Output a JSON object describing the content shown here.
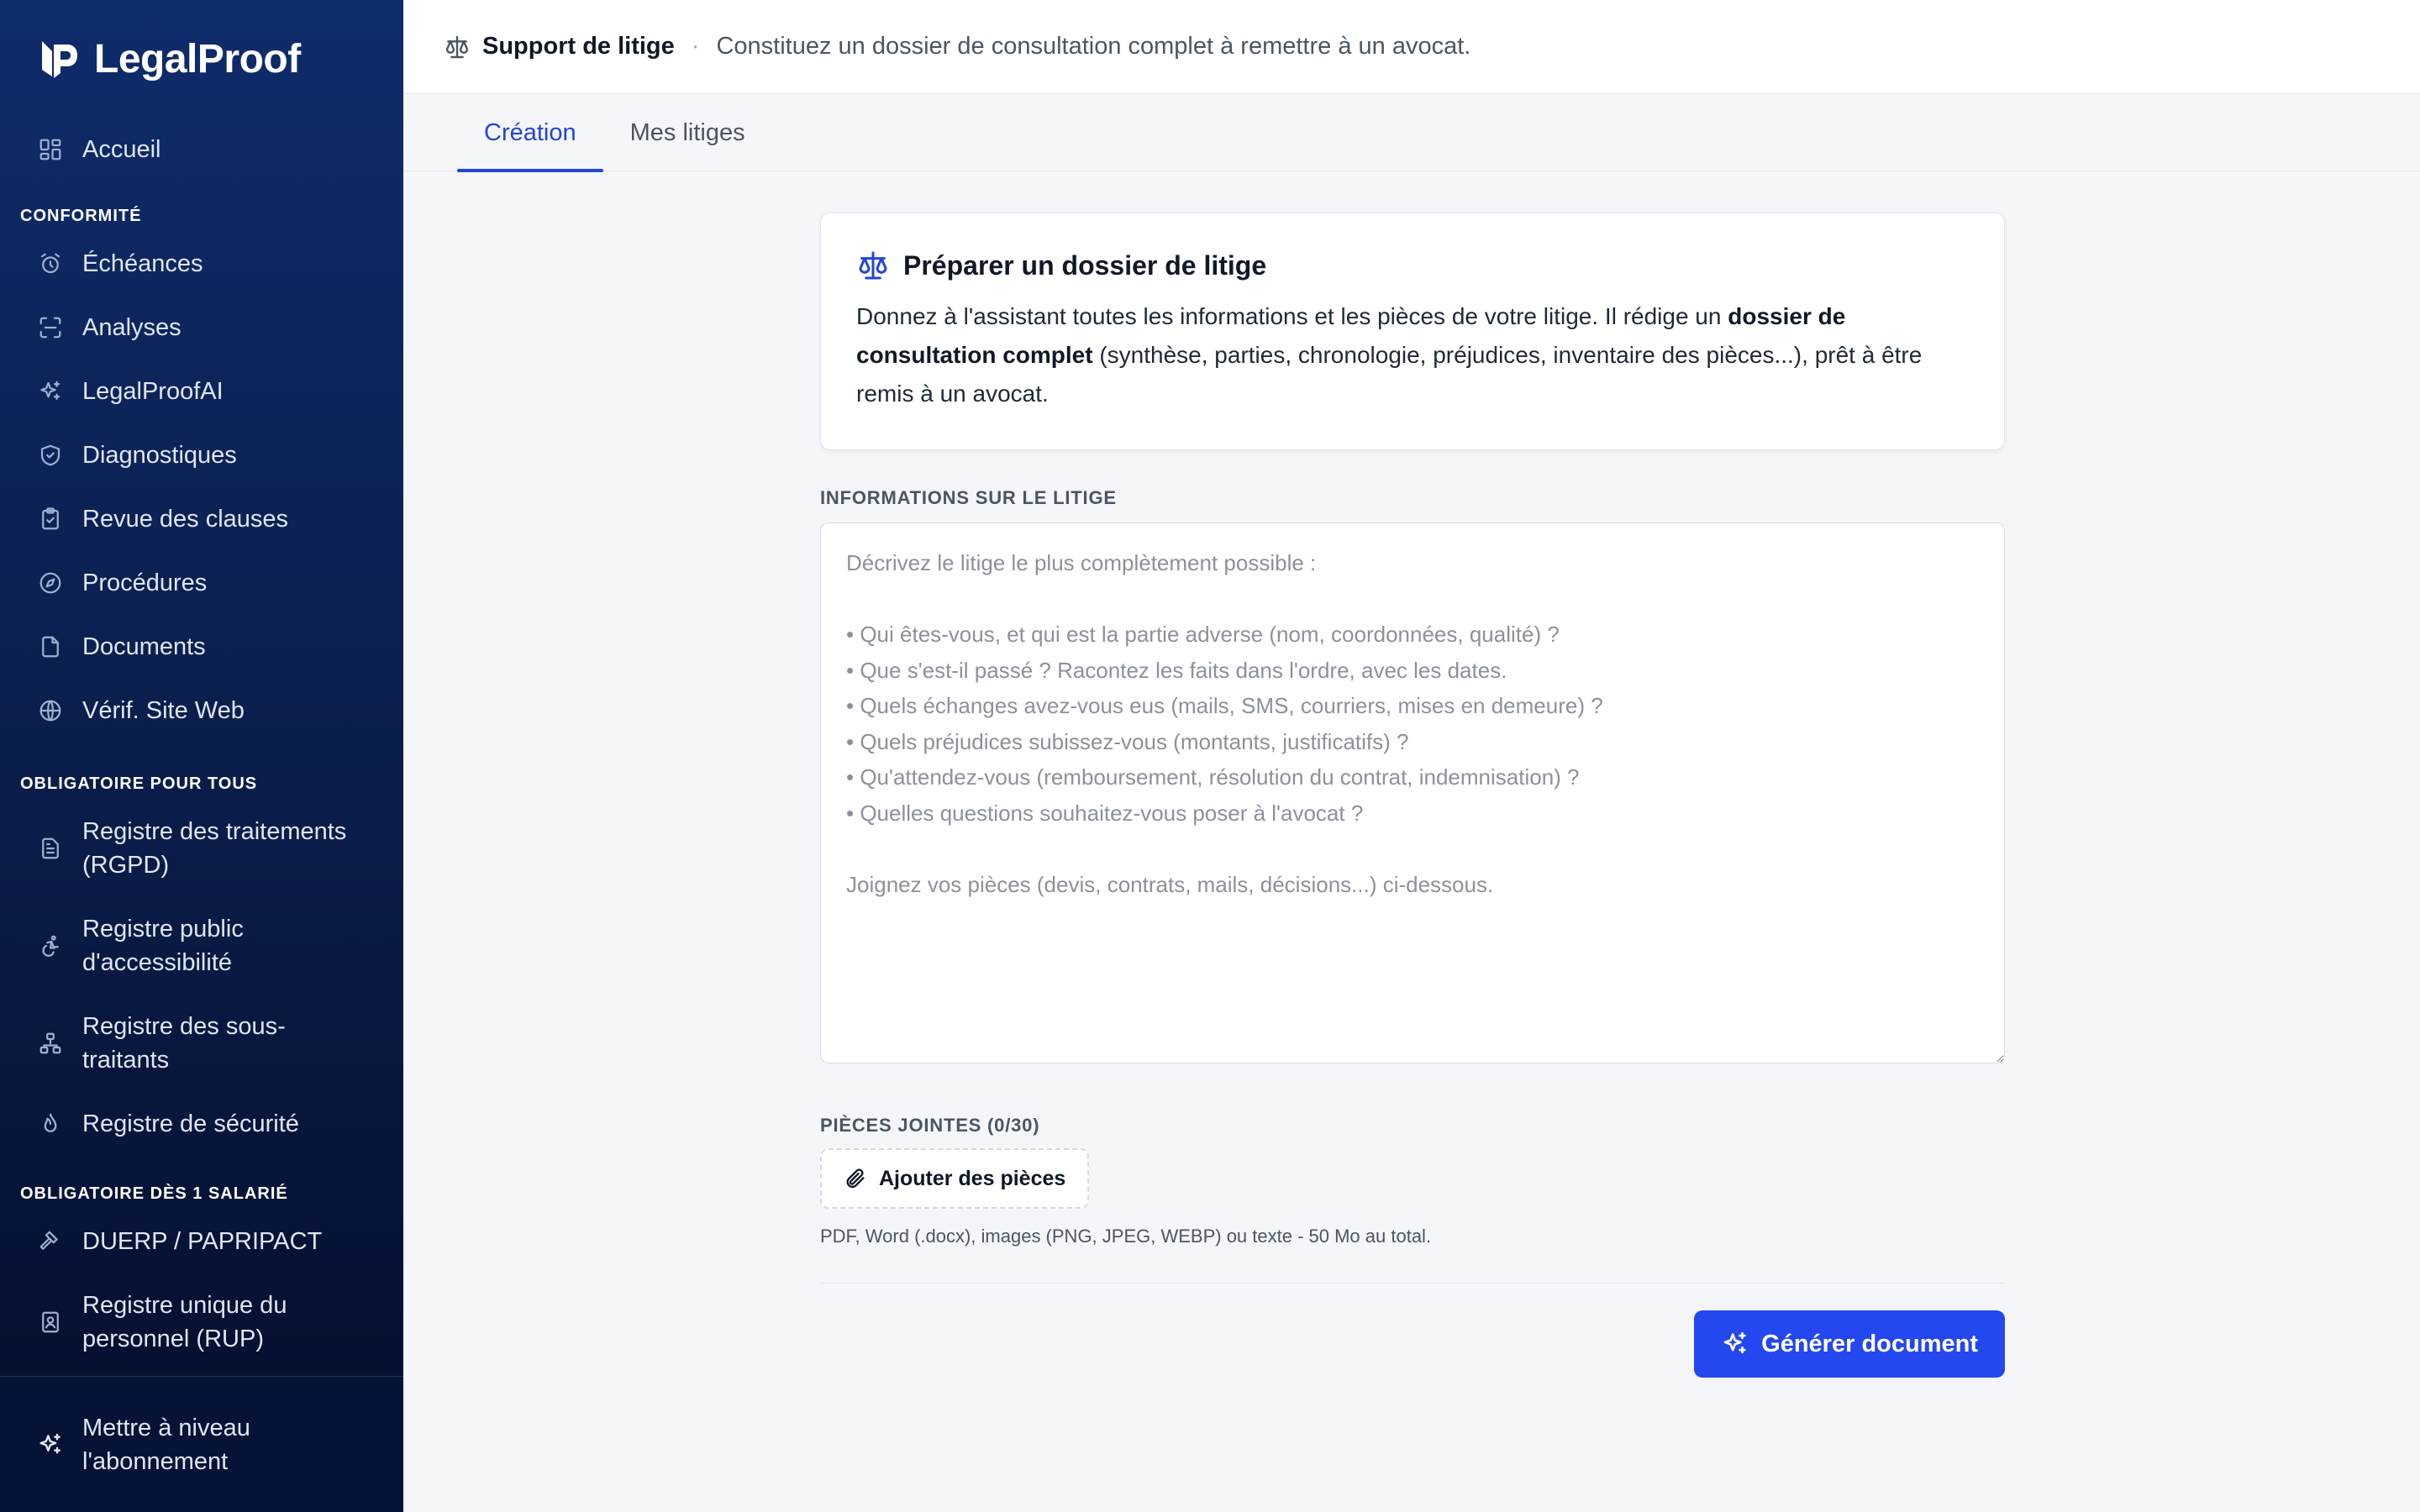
{
  "brand": {
    "name": "LegalProof",
    "icon": "legalproof-logo-icon"
  },
  "sidebar": {
    "home": {
      "label": "Accueil",
      "icon": "dashboard-icon"
    },
    "sections": [
      {
        "title": "CONFORMITÉ",
        "items": [
          {
            "label": "Échéances",
            "icon": "alarm-clock-icon"
          },
          {
            "label": "Analyses",
            "icon": "scan-icon"
          },
          {
            "label": "LegalProofAI",
            "icon": "sparkles-icon"
          },
          {
            "label": "Diagnostiques",
            "icon": "shield-check-icon"
          },
          {
            "label": "Revue des clauses",
            "icon": "clipboard-check-icon"
          },
          {
            "label": "Procédures",
            "icon": "compass-icon"
          },
          {
            "label": "Documents",
            "icon": "file-icon"
          },
          {
            "label": "Vérif. Site Web",
            "icon": "globe-icon"
          }
        ]
      },
      {
        "title": "OBLIGATOIRE POUR TOUS",
        "items": [
          {
            "label": "Registre des traitements (RGPD)",
            "icon": "file-list-icon"
          },
          {
            "label": "Registre public d'accessibilité",
            "icon": "accessibility-icon"
          },
          {
            "label": "Registre des sous-traitants",
            "icon": "network-icon"
          },
          {
            "label": "Registre de sécurité",
            "icon": "flame-icon"
          }
        ]
      },
      {
        "title": "OBLIGATOIRE DÈS 1 SALARIÉ",
        "items": [
          {
            "label": "DUERP / PAPRIPACT",
            "icon": "hammer-icon"
          },
          {
            "label": "Registre unique du personnel (RUP)",
            "icon": "id-badge-icon"
          }
        ]
      }
    ],
    "upgrade": {
      "label": "Mettre à niveau l'abonnement",
      "icon": "sparkles-icon"
    }
  },
  "topbar": {
    "icon": "scale-icon",
    "title": "Support de litige",
    "separator": "·",
    "subtitle": "Constituez un dossier de consultation complet à remettre à un avocat."
  },
  "tabs": [
    {
      "label": "Création",
      "active": true
    },
    {
      "label": "Mes litiges",
      "active": false
    }
  ],
  "intro": {
    "icon": "scale-icon",
    "title": "Préparer un dossier de litige",
    "text_before": "Donnez à l'assistant toutes les informations et les pièces de votre litige. Il rédige un ",
    "text_bold": "dossier de consultation complet",
    "text_after": " (synthèse, parties, chronologie, préjudices, inventaire des pièces...), prêt à être remis à un avocat."
  },
  "form": {
    "info_label": "INFORMATIONS SUR LE LITIGE",
    "info_value": "",
    "info_placeholder": "Décrivez le litige le plus complètement possible :\n\n• Qui êtes-vous, et qui est la partie adverse (nom, coordonnées, qualité) ?\n• Que s'est-il passé ? Racontez les faits dans l'ordre, avec les dates.\n• Quels échanges avez-vous eus (mails, SMS, courriers, mises en demeure) ?\n• Quels préjudices subissez-vous (montants, justificatifs) ?\n• Qu'attendez-vous (remboursement, résolution du contrat, indemnisation) ?\n• Quelles questions souhaitez-vous poser à l'avocat ?\n\nJoignez vos pièces (devis, contrats, mails, décisions...) ci-dessous.",
    "attachments_label": "PIÈCES JOINTES (0/30)",
    "attach_button": "Ajouter des pièces",
    "attach_icon": "paperclip-icon",
    "attach_hint": "PDF, Word (.docx), images (PNG, JPEG, WEBP) ou texte - 50 Mo au total.",
    "generate_button": "Générer document",
    "generate_icon": "sparkles-icon"
  },
  "colors": {
    "accent": "#2344d6",
    "button": "#2447f0",
    "sidebar_top": "#0f2c6b",
    "sidebar_bottom": "#050d2b"
  }
}
